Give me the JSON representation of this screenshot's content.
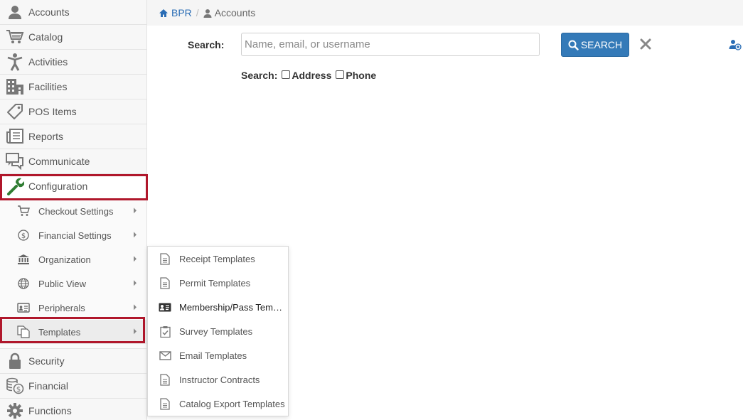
{
  "sidebar": {
    "items": [
      {
        "label": "Accounts",
        "icon": "user-icon"
      },
      {
        "label": "Catalog",
        "icon": "cart-icon"
      },
      {
        "label": "Activities",
        "icon": "person-activity-icon"
      },
      {
        "label": "Facilities",
        "icon": "building-icon"
      },
      {
        "label": "POS Items",
        "icon": "tag-icon"
      },
      {
        "label": "Reports",
        "icon": "reports-icon"
      },
      {
        "label": "Communicate",
        "icon": "chat-icon"
      },
      {
        "label": "Configuration",
        "icon": "wrench-icon"
      }
    ],
    "config_sub": [
      {
        "label": "Checkout Settings",
        "icon": "cart-icon"
      },
      {
        "label": "Financial Settings",
        "icon": "dollar-circle-icon"
      },
      {
        "label": "Organization",
        "icon": "bank-icon"
      },
      {
        "label": "Public View",
        "icon": "globe-icon"
      },
      {
        "label": "Peripherals",
        "icon": "id-card-icon"
      },
      {
        "label": "Templates",
        "icon": "copy-icon"
      }
    ],
    "bottom_items": [
      {
        "label": "Security",
        "icon": "lock-icon"
      },
      {
        "label": "Financial",
        "icon": "coins-icon"
      },
      {
        "label": "Functions",
        "icon": "gear-icon"
      }
    ]
  },
  "breadcrumb": {
    "home": "BPR",
    "separator": "/",
    "current": "Accounts"
  },
  "search": {
    "label": "Search:",
    "placeholder": "Name, email, or username",
    "value": "",
    "button_label": "SEARCH",
    "options_label": "Search:",
    "options": [
      {
        "label": "Address",
        "checked": false
      },
      {
        "label": "Phone",
        "checked": false
      }
    ]
  },
  "templates_flyout": {
    "items": [
      {
        "label": "Receipt Templates",
        "icon": "document-icon"
      },
      {
        "label": "Permit Templates",
        "icon": "document-icon"
      },
      {
        "label": "Membership/Pass Templ...",
        "icon": "id-card-icon"
      },
      {
        "label": "Survey Templates",
        "icon": "clipboard-check-icon"
      },
      {
        "label": "Email Templates",
        "icon": "envelope-icon"
      },
      {
        "label": "Instructor Contracts",
        "icon": "document-icon"
      },
      {
        "label": "Catalog Export Templates",
        "icon": "document-icon"
      }
    ]
  },
  "colors": {
    "accent": "#347ab8",
    "link": "#2a6db5",
    "highlight": "#b0172b",
    "config_icon": "#2f7d32"
  }
}
